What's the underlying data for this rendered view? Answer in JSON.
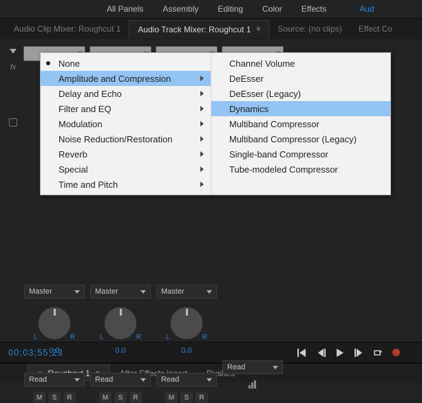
{
  "workspace_tabs": {
    "t0": "All Panels",
    "t1": "Assembly",
    "t2": "Editing",
    "t3": "Color",
    "t4": "Effects",
    "t5": "Aud"
  },
  "panel_tabs": {
    "audio_clip": "Audio Clip Mixer: Roughcut 1",
    "audio_track": "Audio Track Mixer: Roughcut 1",
    "source": "Source: (no clips)",
    "effect": "Effect Co"
  },
  "context_menu": {
    "left": {
      "none": "None",
      "amp": "Amplitude and Compression",
      "delay": "Delay and Echo",
      "filter": "Filter and EQ",
      "mod": "Modulation",
      "noise": "Noise Reduction/Restoration",
      "reverb": "Reverb",
      "special": "Special",
      "time": "Time and Pitch"
    },
    "right": {
      "chanvol": "Channel Volume",
      "deesser": "DeEsser",
      "deesser_legacy": "DeEsser (Legacy)",
      "dynamics": "Dynamics",
      "multiband": "Multiband Compressor",
      "multiband_legacy": "Multiband Compressor (Legacy)",
      "singleband": "Single-band Compressor",
      "tube": "Tube-modeled Compressor"
    }
  },
  "channel": {
    "master": "Master",
    "l": "L",
    "r": "R",
    "pan": "0.0",
    "read": "Read",
    "m": "M",
    "s": "S",
    "rbtn": "R"
  },
  "transport": {
    "timecode": "00;03;55;23"
  },
  "bottom_tabs": {
    "roughcut": "Roughcut 1",
    "ae": "After Effects Insert",
    "rushes": "Rushes"
  }
}
